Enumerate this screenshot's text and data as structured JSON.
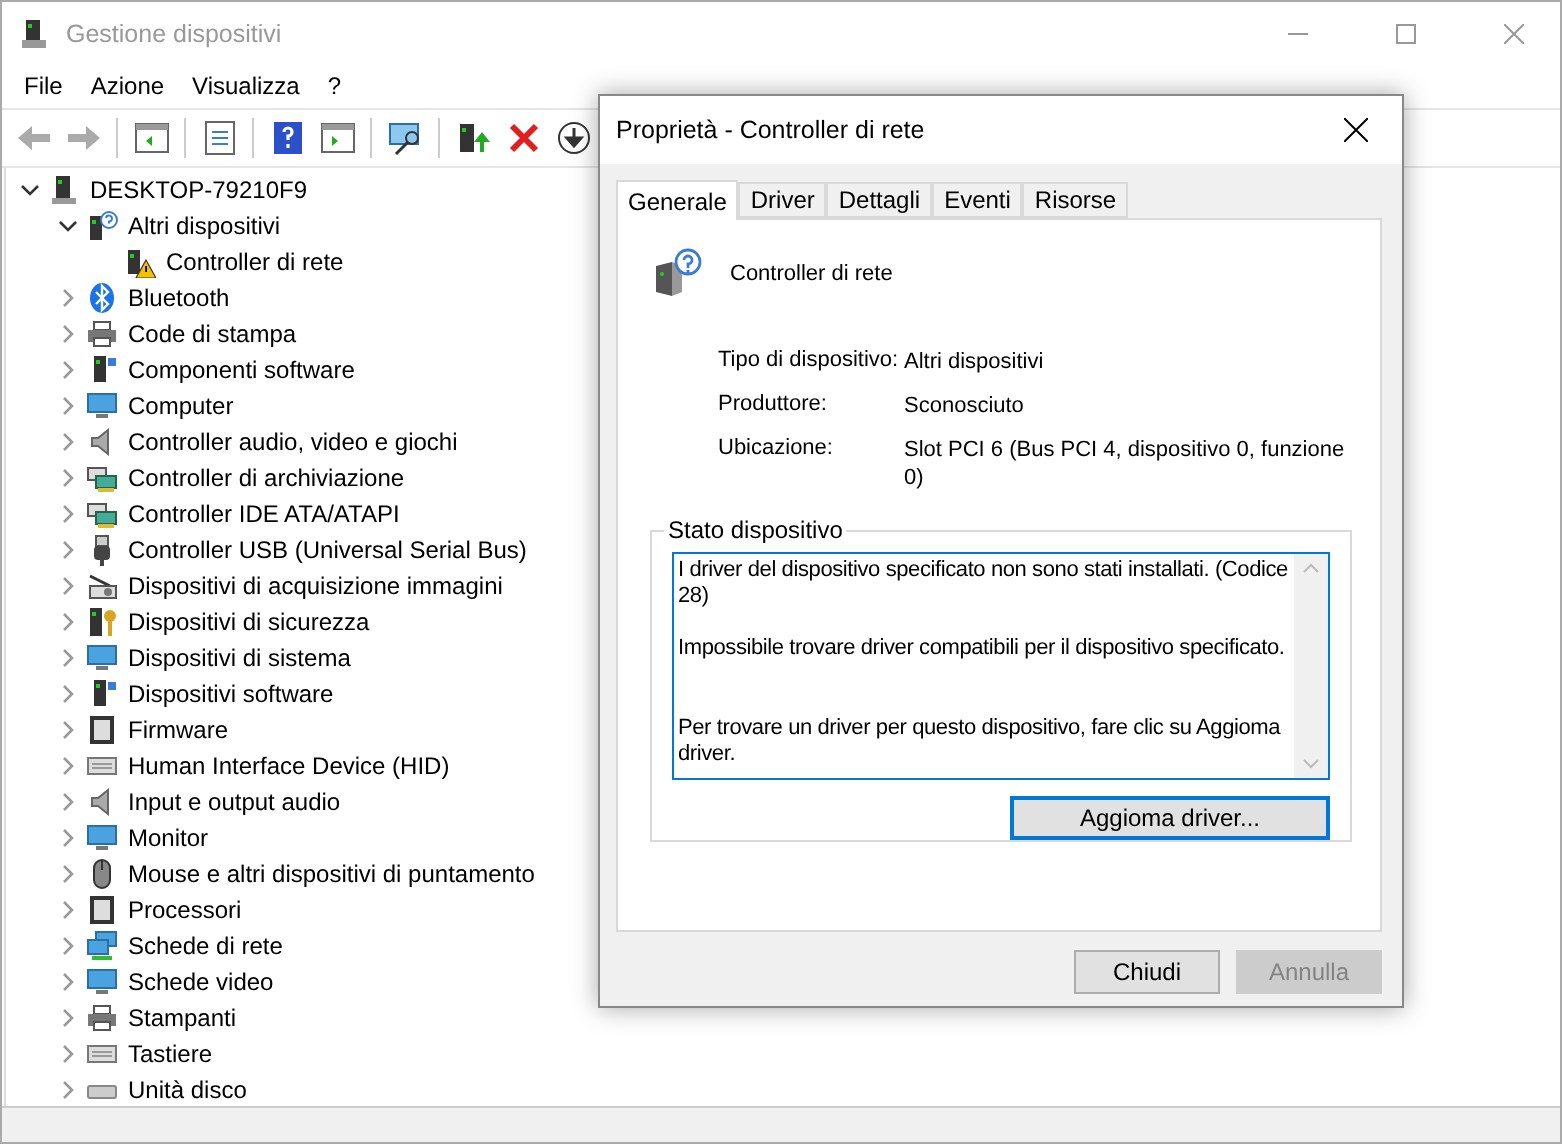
{
  "window": {
    "title": "Gestione dispositivi",
    "active": false
  },
  "menu": [
    "File",
    "Azione",
    "Visualizza",
    "?"
  ],
  "toolbar": [
    {
      "kind": "back",
      "disabled": true
    },
    {
      "kind": "forward",
      "disabled": true
    },
    {
      "kind": "sep"
    },
    {
      "kind": "console"
    },
    {
      "kind": "sep"
    },
    {
      "kind": "properties"
    },
    {
      "kind": "sep"
    },
    {
      "kind": "help"
    },
    {
      "kind": "pane"
    },
    {
      "kind": "sep"
    },
    {
      "kind": "scan"
    },
    {
      "kind": "sep"
    },
    {
      "kind": "update"
    },
    {
      "kind": "remove"
    },
    {
      "kind": "disable"
    }
  ],
  "tree": [
    {
      "label": "DESKTOP-79210F9",
      "kind": "computer",
      "expanded": true,
      "children": [
        {
          "label": "Altri dispositivi",
          "kind": "unknown",
          "expanded": true,
          "children": [
            {
              "label": "Controller di rete",
              "kind": "warning"
            }
          ]
        },
        {
          "label": "Bluetooth",
          "kind": "bluetooth",
          "expanded": false
        },
        {
          "label": "Code di stampa",
          "kind": "printer",
          "expanded": false
        },
        {
          "label": "Componenti software",
          "kind": "tower",
          "expanded": false
        },
        {
          "label": "Computer",
          "kind": "monitor",
          "expanded": false
        },
        {
          "label": "Controller audio, video e giochi",
          "kind": "speaker",
          "expanded": false
        },
        {
          "label": "Controller di archiviazione",
          "kind": "card",
          "expanded": false
        },
        {
          "label": "Controller IDE ATA/ATAPI",
          "kind": "card",
          "expanded": false
        },
        {
          "label": "Controller USB (Universal Serial Bus)",
          "kind": "usb",
          "expanded": false
        },
        {
          "label": "Dispositivi di acquisizione immagini",
          "kind": "camera",
          "expanded": false
        },
        {
          "label": "Dispositivi di sicurezza",
          "kind": "key",
          "expanded": false
        },
        {
          "label": "Dispositivi di sistema",
          "kind": "monitor",
          "expanded": false
        },
        {
          "label": "Dispositivi software",
          "kind": "tower",
          "expanded": false
        },
        {
          "label": "Firmware",
          "kind": "chip",
          "expanded": false
        },
        {
          "label": "Human Interface Device (HID)",
          "kind": "keyboard",
          "expanded": false
        },
        {
          "label": "Input e output audio",
          "kind": "speaker",
          "expanded": false
        },
        {
          "label": "Monitor",
          "kind": "monitor",
          "expanded": false
        },
        {
          "label": "Mouse e altri dispositivi di puntamento",
          "kind": "mouse",
          "expanded": false
        },
        {
          "label": "Processori",
          "kind": "chip",
          "expanded": false
        },
        {
          "label": "Schede di rete",
          "kind": "network",
          "expanded": false
        },
        {
          "label": "Schede video",
          "kind": "monitor",
          "expanded": false
        },
        {
          "label": "Stampanti",
          "kind": "printer",
          "expanded": false
        },
        {
          "label": "Tastiere",
          "kind": "keyboard",
          "expanded": false
        },
        {
          "label": "Unità disco",
          "kind": "disk",
          "expanded": false
        }
      ]
    }
  ],
  "dialog": {
    "title": "Proprietà - Controller di rete",
    "tabs": [
      {
        "label": "Generale",
        "selected": true
      },
      {
        "label": "Driver",
        "selected": false
      },
      {
        "label": "Dettagli",
        "selected": false
      },
      {
        "label": "Eventi",
        "selected": false
      },
      {
        "label": "Risorse",
        "selected": false
      }
    ],
    "device_name": "Controller di rete",
    "properties": [
      {
        "label": "Tipo di dispositivo:",
        "value": "Altri dispositivi"
      },
      {
        "label": "Produttore:",
        "value": "Sconosciuto"
      },
      {
        "label": "Ubicazione:",
        "value": "Slot PCI 6 (Bus PCI 4, dispositivo 0, funzione 0)"
      }
    ],
    "status_group": "Stato dispositivo",
    "status_text": [
      "I driver del dispositivo specificato non sono stati installati. (Codice 28)",
      "Impossibile trovare driver compatibili per il dispositivo specificato.",
      "Per trovare un driver per questo dispositivo, fare clic su Aggioma driver."
    ],
    "action_button": "Aggioma driver...",
    "buttons": [
      {
        "label": "Chiudi",
        "disabled": false
      },
      {
        "label": "Annulla",
        "disabled": true
      }
    ]
  }
}
